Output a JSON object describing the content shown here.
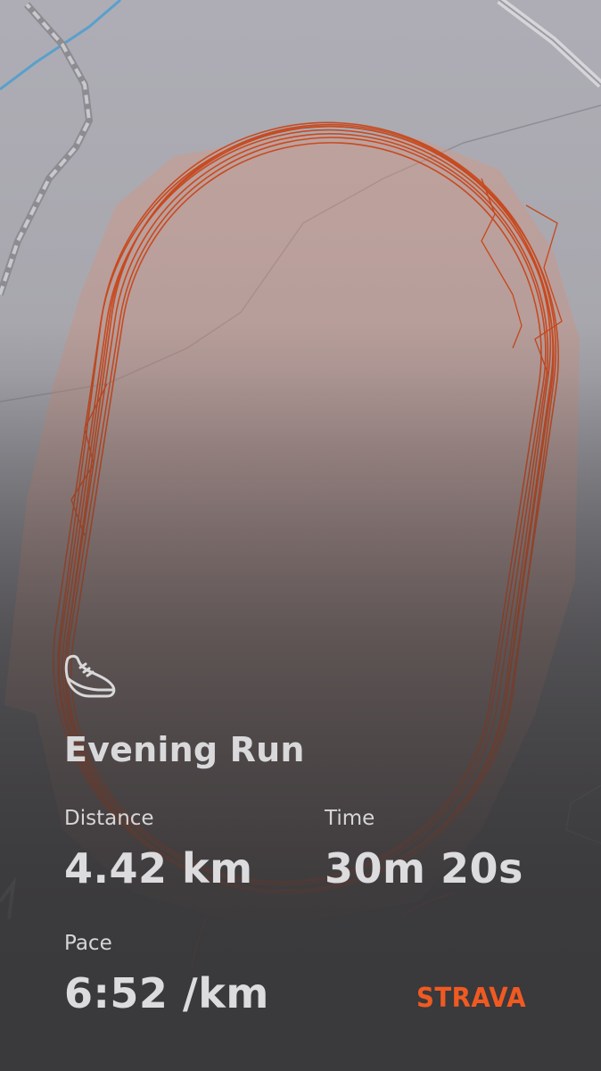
{
  "activity": {
    "title": "Evening Run",
    "icon": "running-shoe-icon"
  },
  "stats": {
    "distance_label": "Distance",
    "distance_value": "4.42 km",
    "time_label": "Time",
    "time_value": "30m 20s",
    "pace_label": "Pace",
    "pace_value": "6:52 /km"
  },
  "brand": {
    "name": "STRAVA",
    "color": "#f05a22"
  },
  "colors": {
    "route": "#c8461a",
    "map_background": "#a9a8b0",
    "track_fill": "#d49683",
    "river": "#5aa0cc"
  }
}
